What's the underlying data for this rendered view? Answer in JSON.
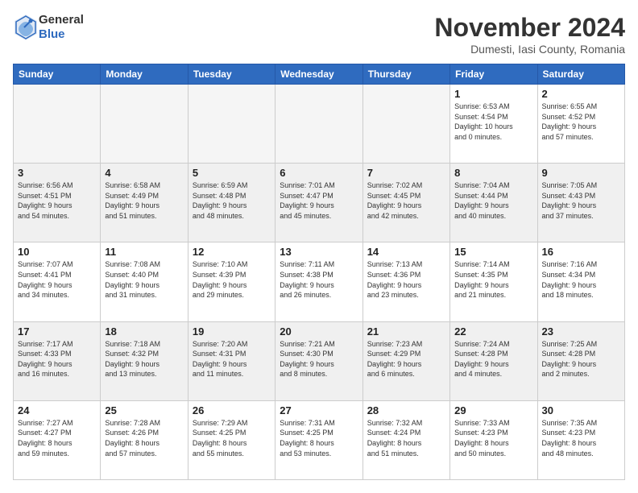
{
  "logo": {
    "line1": "General",
    "line2": "Blue"
  },
  "title": "November 2024",
  "subtitle": "Dumesti, Iasi County, Romania",
  "weekdays": [
    "Sunday",
    "Monday",
    "Tuesday",
    "Wednesday",
    "Thursday",
    "Friday",
    "Saturday"
  ],
  "weeks": [
    [
      {
        "day": "",
        "info": ""
      },
      {
        "day": "",
        "info": ""
      },
      {
        "day": "",
        "info": ""
      },
      {
        "day": "",
        "info": ""
      },
      {
        "day": "",
        "info": ""
      },
      {
        "day": "1",
        "info": "Sunrise: 6:53 AM\nSunset: 4:54 PM\nDaylight: 10 hours\nand 0 minutes."
      },
      {
        "day": "2",
        "info": "Sunrise: 6:55 AM\nSunset: 4:52 PM\nDaylight: 9 hours\nand 57 minutes."
      }
    ],
    [
      {
        "day": "3",
        "info": "Sunrise: 6:56 AM\nSunset: 4:51 PM\nDaylight: 9 hours\nand 54 minutes."
      },
      {
        "day": "4",
        "info": "Sunrise: 6:58 AM\nSunset: 4:49 PM\nDaylight: 9 hours\nand 51 minutes."
      },
      {
        "day": "5",
        "info": "Sunrise: 6:59 AM\nSunset: 4:48 PM\nDaylight: 9 hours\nand 48 minutes."
      },
      {
        "day": "6",
        "info": "Sunrise: 7:01 AM\nSunset: 4:47 PM\nDaylight: 9 hours\nand 45 minutes."
      },
      {
        "day": "7",
        "info": "Sunrise: 7:02 AM\nSunset: 4:45 PM\nDaylight: 9 hours\nand 42 minutes."
      },
      {
        "day": "8",
        "info": "Sunrise: 7:04 AM\nSunset: 4:44 PM\nDaylight: 9 hours\nand 40 minutes."
      },
      {
        "day": "9",
        "info": "Sunrise: 7:05 AM\nSunset: 4:43 PM\nDaylight: 9 hours\nand 37 minutes."
      }
    ],
    [
      {
        "day": "10",
        "info": "Sunrise: 7:07 AM\nSunset: 4:41 PM\nDaylight: 9 hours\nand 34 minutes."
      },
      {
        "day": "11",
        "info": "Sunrise: 7:08 AM\nSunset: 4:40 PM\nDaylight: 9 hours\nand 31 minutes."
      },
      {
        "day": "12",
        "info": "Sunrise: 7:10 AM\nSunset: 4:39 PM\nDaylight: 9 hours\nand 29 minutes."
      },
      {
        "day": "13",
        "info": "Sunrise: 7:11 AM\nSunset: 4:38 PM\nDaylight: 9 hours\nand 26 minutes."
      },
      {
        "day": "14",
        "info": "Sunrise: 7:13 AM\nSunset: 4:36 PM\nDaylight: 9 hours\nand 23 minutes."
      },
      {
        "day": "15",
        "info": "Sunrise: 7:14 AM\nSunset: 4:35 PM\nDaylight: 9 hours\nand 21 minutes."
      },
      {
        "day": "16",
        "info": "Sunrise: 7:16 AM\nSunset: 4:34 PM\nDaylight: 9 hours\nand 18 minutes."
      }
    ],
    [
      {
        "day": "17",
        "info": "Sunrise: 7:17 AM\nSunset: 4:33 PM\nDaylight: 9 hours\nand 16 minutes."
      },
      {
        "day": "18",
        "info": "Sunrise: 7:18 AM\nSunset: 4:32 PM\nDaylight: 9 hours\nand 13 minutes."
      },
      {
        "day": "19",
        "info": "Sunrise: 7:20 AM\nSunset: 4:31 PM\nDaylight: 9 hours\nand 11 minutes."
      },
      {
        "day": "20",
        "info": "Sunrise: 7:21 AM\nSunset: 4:30 PM\nDaylight: 9 hours\nand 8 minutes."
      },
      {
        "day": "21",
        "info": "Sunrise: 7:23 AM\nSunset: 4:29 PM\nDaylight: 9 hours\nand 6 minutes."
      },
      {
        "day": "22",
        "info": "Sunrise: 7:24 AM\nSunset: 4:28 PM\nDaylight: 9 hours\nand 4 minutes."
      },
      {
        "day": "23",
        "info": "Sunrise: 7:25 AM\nSunset: 4:28 PM\nDaylight: 9 hours\nand 2 minutes."
      }
    ],
    [
      {
        "day": "24",
        "info": "Sunrise: 7:27 AM\nSunset: 4:27 PM\nDaylight: 8 hours\nand 59 minutes."
      },
      {
        "day": "25",
        "info": "Sunrise: 7:28 AM\nSunset: 4:26 PM\nDaylight: 8 hours\nand 57 minutes."
      },
      {
        "day": "26",
        "info": "Sunrise: 7:29 AM\nSunset: 4:25 PM\nDaylight: 8 hours\nand 55 minutes."
      },
      {
        "day": "27",
        "info": "Sunrise: 7:31 AM\nSunset: 4:25 PM\nDaylight: 8 hours\nand 53 minutes."
      },
      {
        "day": "28",
        "info": "Sunrise: 7:32 AM\nSunset: 4:24 PM\nDaylight: 8 hours\nand 51 minutes."
      },
      {
        "day": "29",
        "info": "Sunrise: 7:33 AM\nSunset: 4:23 PM\nDaylight: 8 hours\nand 50 minutes."
      },
      {
        "day": "30",
        "info": "Sunrise: 7:35 AM\nSunset: 4:23 PM\nDaylight: 8 hours\nand 48 minutes."
      }
    ]
  ]
}
